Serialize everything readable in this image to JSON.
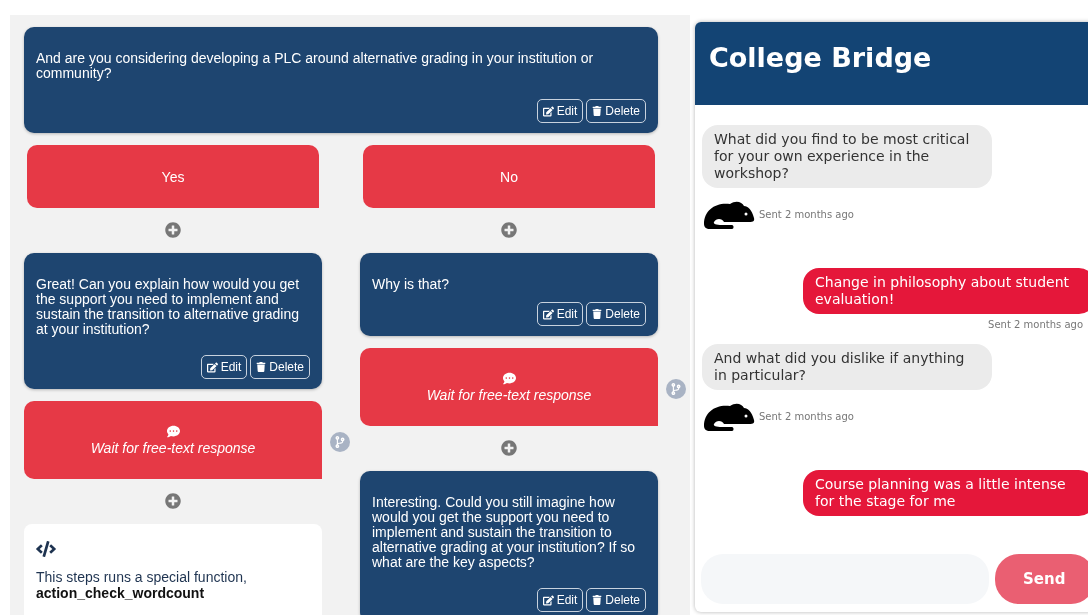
{
  "flow": {
    "question": {
      "kind": "message",
      "text": "And are you considering developing a PLC around alternative grading in your institution or community?",
      "edit_label": "Edit",
      "delete_label": "Delete"
    },
    "columns": [
      {
        "steps": [
          {
            "kind": "answer",
            "text": "Yes"
          },
          {
            "kind": "add"
          },
          {
            "kind": "message",
            "text": "Great! Can you explain how would you get the support you need to implement and sustain the transition to alternative grading at your institution?",
            "edit_label": "Edit",
            "delete_label": "Delete"
          },
          {
            "kind": "wait",
            "text": "Wait for free-text response"
          },
          {
            "kind": "add"
          },
          {
            "kind": "function",
            "text": "This steps runs a special function, **action_check_wordcount**"
          }
        ]
      },
      {
        "steps": [
          {
            "kind": "answer",
            "text": "No"
          },
          {
            "kind": "add"
          },
          {
            "kind": "message",
            "text": "Why is that?",
            "edit_label": "Edit",
            "delete_label": "Delete"
          },
          {
            "kind": "wait",
            "text": "Wait for free-text response"
          },
          {
            "kind": "add"
          },
          {
            "kind": "message",
            "text": "Interesting. Could you still imagine how would you get the support you need to implement and sustain the transition to alternative grading at your institution? If so what are the key aspects?",
            "edit_label": "Edit",
            "delete_label": "Delete"
          }
        ]
      }
    ]
  },
  "chat": {
    "title": "College Bridge",
    "messages": [
      {
        "kind": "bot",
        "text": "What did you find to be most critical for your own experience in the workshop?",
        "time": "Sent 2 months ago"
      },
      {
        "kind": "user",
        "text": "Change in philosophy about student evaluation!",
        "time": "Sent 2 months ago"
      },
      {
        "kind": "bot",
        "text": "And what did you dislike if anything in particular?",
        "time": "Sent 2 months ago"
      },
      {
        "kind": "user",
        "text": "Course planning was a little intense for the stage for me"
      }
    ],
    "send_label": "Send"
  }
}
